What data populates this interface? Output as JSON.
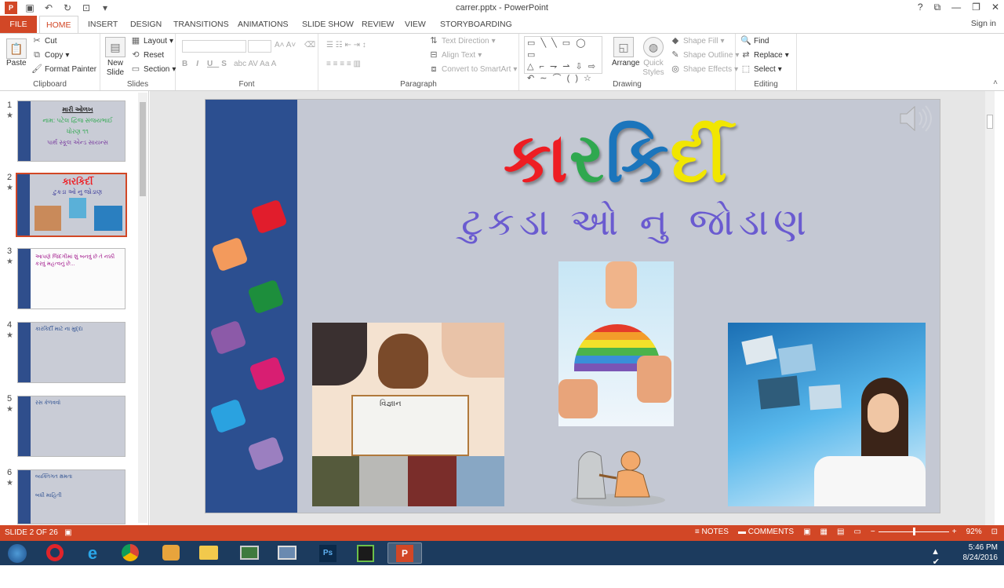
{
  "window": {
    "title": "carrer.pptx - PowerPoint",
    "signin": "Sign in"
  },
  "tabs": [
    "FILE",
    "HOME",
    "INSERT",
    "DESIGN",
    "TRANSITIONS",
    "ANIMATIONS",
    "SLIDE SHOW",
    "REVIEW",
    "VIEW",
    "STORYBOARDING"
  ],
  "ribbon": {
    "clipboard": {
      "paste": "Paste",
      "cut": "Cut",
      "copy": "Copy",
      "format_painter": "Format Painter",
      "label": "Clipboard"
    },
    "slides": {
      "new_slide": "New Slide",
      "layout": "Layout",
      "reset": "Reset",
      "section": "Section",
      "label": "Slides"
    },
    "font": {
      "label": "Font"
    },
    "paragraph": {
      "text_direction": "Text Direction",
      "align_text": "Align Text",
      "convert_smartart": "Convert to SmartArt",
      "label": "Paragraph"
    },
    "drawing": {
      "arrange": "Arrange",
      "quick_styles": "Quick Styles",
      "shape_fill": "Shape Fill",
      "shape_outline": "Shape Outline",
      "shape_effects": "Shape Effects",
      "label": "Drawing"
    },
    "editing": {
      "find": "Find",
      "replace": "Replace",
      "select": "Select",
      "label": "Editing"
    }
  },
  "thumbnails": [
    {
      "num": "1",
      "lines": [
        "મારી ઓળખ",
        "નામ: પટેલ દ્વિજ સંજયભાઈ",
        "ધોરણ ૧૧",
        "પાર્થ સ્કૂલ એન્ડ સાયન્સ"
      ]
    },
    {
      "num": "2",
      "lines": [
        "કારકિર્દી",
        "ટુકડા ઓ નુ જોડાણ"
      ]
    },
    {
      "num": "3",
      "lines": [
        "આપણે જિંદગીમાં શું બનવું છે તે નક્કી કરવું મહત્વનું છે..."
      ]
    },
    {
      "num": "4",
      "lines": [
        "કારકિર્દી માટે ના મુદ્દા"
      ]
    },
    {
      "num": "5",
      "lines": [
        "રસ કેળવવો"
      ]
    },
    {
      "num": "6",
      "lines": [
        "વ્યક્તિગત ક્ષમતા",
        "બધી માહિતી"
      ]
    }
  ],
  "slide": {
    "title_chars": [
      {
        "t": "કા",
        "color": "#ee1d23"
      },
      {
        "t": "ર",
        "color": "#2fa84f"
      },
      {
        "t": "કિ",
        "color": "#1b75bc"
      },
      {
        "t": "ર્દી",
        "color": "#f1e600"
      }
    ],
    "subtitle": "ટુકડા ઓ નુ જોડાણ",
    "book_text": "વિજ્ઞાન"
  },
  "status": {
    "slide_info": "SLIDE 2 OF 26",
    "notes": "NOTES",
    "comments": "COMMENTS",
    "zoom": "92%"
  },
  "taskbar": {
    "time": "5:46 PM",
    "date": "8/24/2016"
  },
  "colors": {
    "accent": "#d24726",
    "slide_strip": "#2c4f90",
    "taskbar": "#1c3b5e"
  }
}
